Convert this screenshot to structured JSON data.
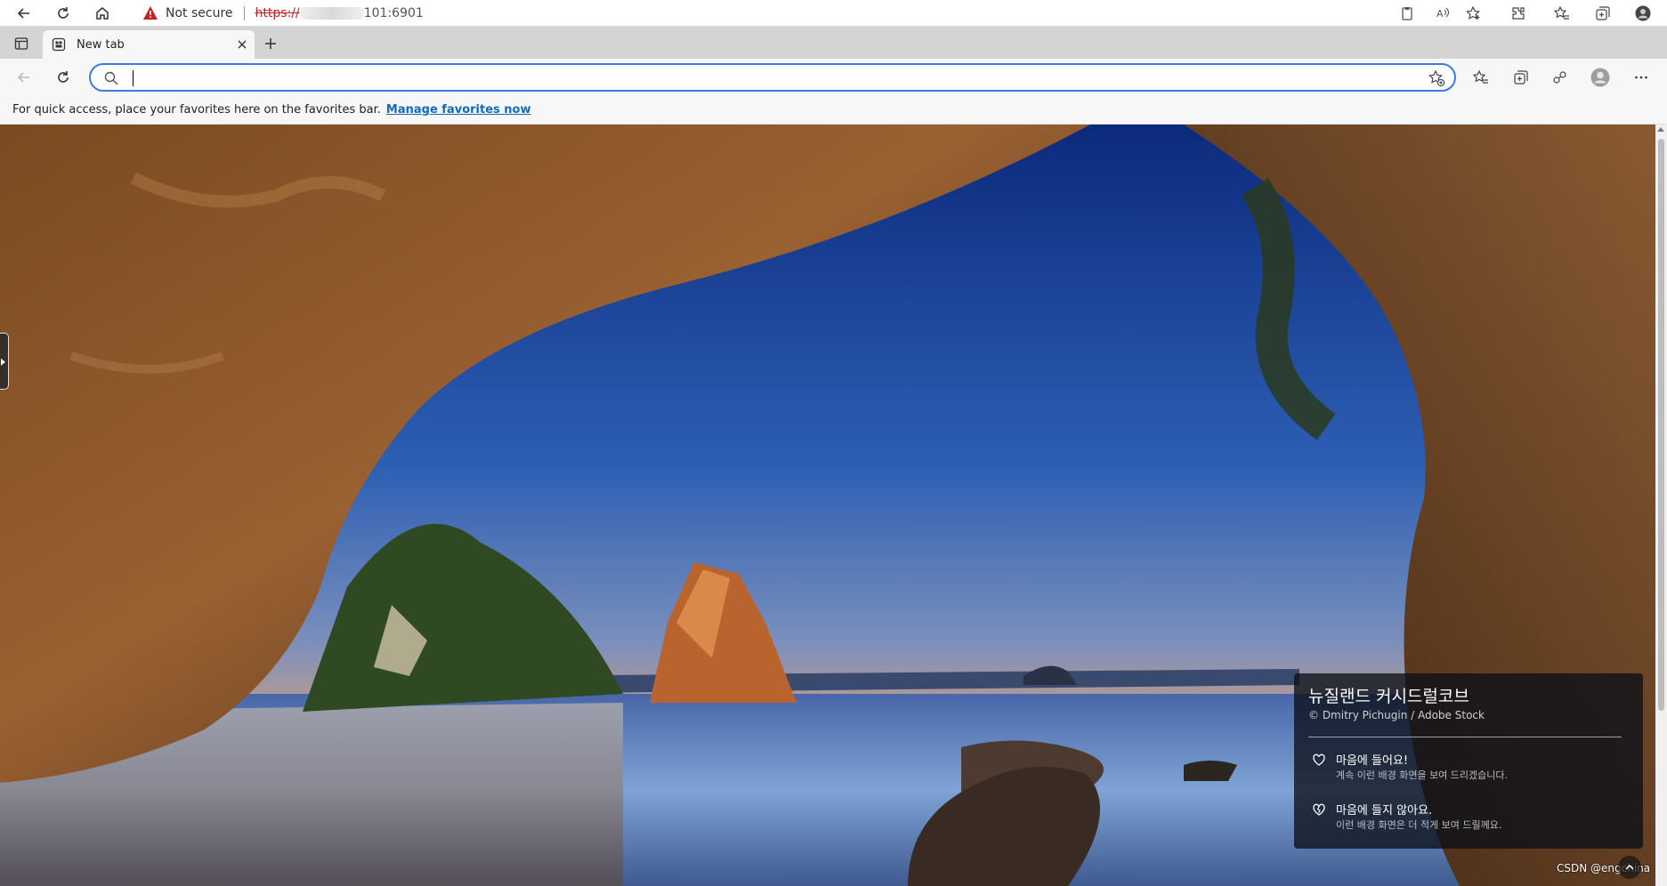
{
  "outer_browser": {
    "security_label": "Not secure",
    "url_scheme": "https://",
    "url_tail": "101:6901"
  },
  "tab": {
    "title": "New tab"
  },
  "omnibox": {
    "value": "",
    "placeholder": ""
  },
  "favorites_bar": {
    "prompt": "For quick access, place your favorites here on the favorites bar.",
    "link": "Manage favorites now"
  },
  "background_info": {
    "title": "뉴질랜드 커시드럴코브",
    "credit": "© Dmitry Pichugin / Adobe Stock",
    "options": [
      {
        "icon": "heart-icon",
        "title": "마음에 들어요!",
        "subtitle": "계속 이런 배경 화면을 보여 드리겠습니다."
      },
      {
        "icon": "broken-heart-icon",
        "title": "마음에 들지 않아요.",
        "subtitle": "이런 배경 화면은 더 적게 보여 드릴께요."
      }
    ]
  },
  "watermark": "CSDN @engchina",
  "colors": {
    "accent": "#3c7be0",
    "link": "#0f6cbd",
    "warning": "#c5221f",
    "sky_top": "#0e2b7a",
    "rock": "#6b3f1e"
  }
}
